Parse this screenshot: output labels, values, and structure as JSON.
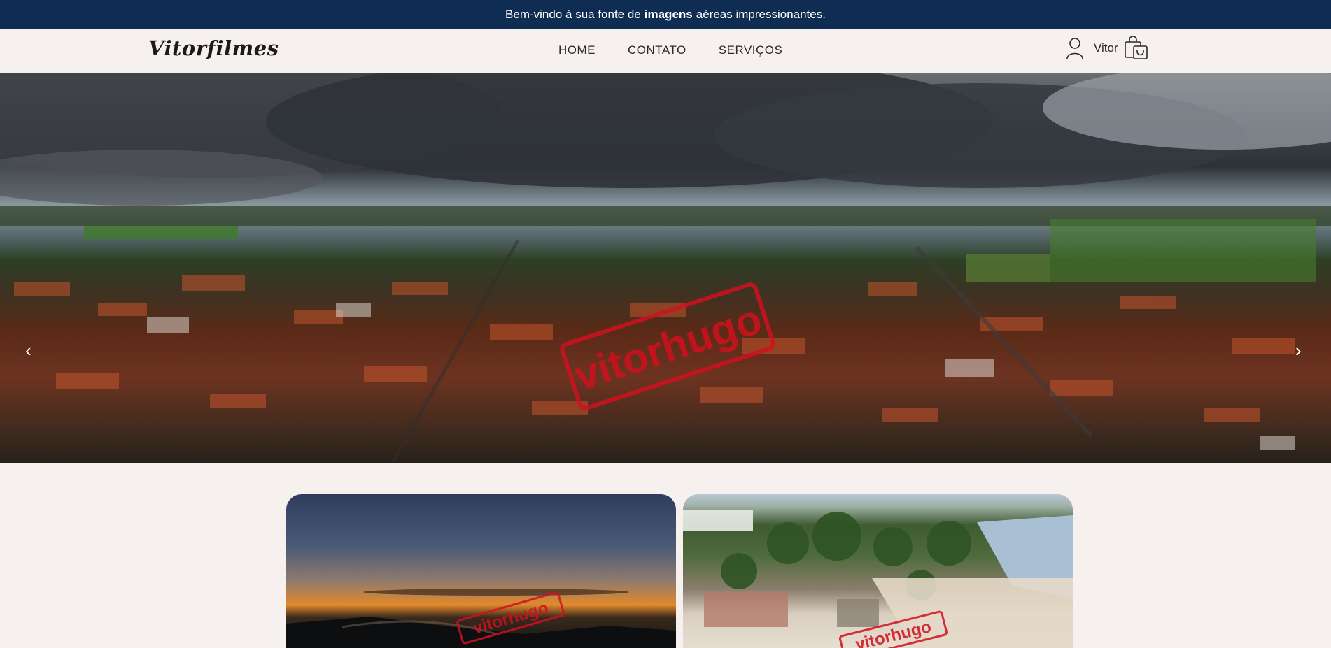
{
  "announcement": {
    "before": "Bem-vindo à sua fonte de",
    "bold": "imagens",
    "after": "aéreas impressionantes."
  },
  "header": {
    "logo": "Vitorfilmes",
    "nav": [
      "HOME",
      "CONTATO",
      "SERVIÇOS"
    ],
    "user_name": "Vitor",
    "icons": {
      "user": "user-icon",
      "cart": "shopping-bag-icon"
    }
  },
  "hero": {
    "watermark": "vitorhugo",
    "prev_arrow": "‹",
    "next_arrow": "›"
  },
  "cards": [
    {
      "watermark": "vitorhugo"
    },
    {
      "watermark": "vitorhugo"
    }
  ],
  "colors": {
    "announcement_bg": "#0f2d52",
    "page_bg": "#f6f1ee",
    "watermark": "#d0101e"
  }
}
